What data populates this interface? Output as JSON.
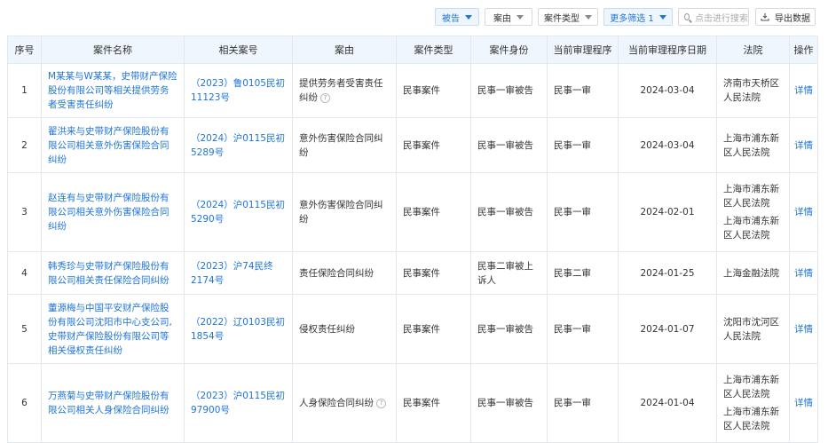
{
  "toolbar": {
    "filters": [
      {
        "label": "被告",
        "active": true
      },
      {
        "label": "案由",
        "active": false
      },
      {
        "label": "案件类型",
        "active": false
      },
      {
        "label": "更多筛选 1",
        "active": true
      }
    ],
    "search_placeholder": "点击进行搜索",
    "export_label": "导出数据"
  },
  "table": {
    "headers": [
      "序号",
      "案件名称",
      "相关案号",
      "案由",
      "案件类型",
      "案件身份",
      "当前审理程序",
      "当前审理程序日期",
      "法院",
      "操作"
    ],
    "rows": [
      {
        "no": "1",
        "name": "M某某与W某某，史带财产保险股份有限公司等相关提供劳务者受害责任纠纷",
        "case_no": "（2023）鲁0105民初11123号",
        "cause": "提供劳务者受害责任纠纷",
        "cause_help": true,
        "type": "民事案件",
        "role": "民事一审被告",
        "stage": "民事一审",
        "date": "2024-03-04",
        "courts": [
          "济南市天桥区人民法院"
        ],
        "action": "详情"
      },
      {
        "no": "2",
        "name": "翟洪来与史带财产保险股份有限公司相关意外伤害保险合同纠纷",
        "case_no": "（2024）沪0115民初5289号",
        "cause": "意外伤害保险合同纠纷",
        "cause_help": false,
        "type": "民事案件",
        "role": "民事一审被告",
        "stage": "民事一审",
        "date": "2024-03-04",
        "courts": [
          "上海市浦东新区人民法院"
        ],
        "action": "详情"
      },
      {
        "no": "3",
        "name": "赵连有与史带财产保险股份有限公司相关意外伤害保险合同纠纷",
        "case_no": "（2024）沪0115民初5290号",
        "cause": "意外伤害保险合同纠纷",
        "cause_help": false,
        "type": "民事案件",
        "role": "民事一审被告",
        "stage": "民事一审",
        "date": "2024-02-01",
        "courts": [
          "上海市浦东新区人民法院",
          "上海市浦东新区人民法院"
        ],
        "action": "详情"
      },
      {
        "no": "4",
        "name": "韩秀珍与史带财产保险股份有限公司相关责任保险合同纠纷",
        "case_no": "（2023）沪74民终2174号",
        "cause": "责任保险合同纠纷",
        "cause_help": false,
        "type": "民事案件",
        "role": "民事二审被上诉人",
        "stage": "民事二审",
        "date": "2024-01-25",
        "courts": [
          "上海金融法院"
        ],
        "action": "详情"
      },
      {
        "no": "5",
        "name": "董源梅与中国平安财产保险股份有限公司沈阳市中心支公司,史带财产保险股份有限公司等相关侵权责任纠纷",
        "case_no": "（2022）辽0103民初1854号",
        "cause": "侵权责任纠纷",
        "cause_help": false,
        "type": "民事案件",
        "role": "民事一审被告",
        "stage": "民事一审",
        "date": "2024-01-07",
        "courts": [
          "沈阳市沈河区人民法院"
        ],
        "action": "详情"
      },
      {
        "no": "6",
        "name": "万燕菊与史带财产保险股份有限公司相关人身保险合同纠纷",
        "case_no": "（2023）沪0115民初97900号",
        "cause": "人身保险合同纠纷",
        "cause_help": true,
        "type": "民事案件",
        "role": "民事一审被告",
        "stage": "民事一审",
        "date": "2024-01-04",
        "courts": [
          "上海市浦东新区人民法院",
          "上海市浦东新区人民法院"
        ],
        "action": "详情"
      }
    ]
  },
  "colors": {
    "link": "#1f74d8",
    "header_bg": "#f0f6fd",
    "border": "#e4e8ee"
  },
  "icons": [
    "caret-down-icon",
    "search-icon",
    "download-icon",
    "help-icon"
  ]
}
